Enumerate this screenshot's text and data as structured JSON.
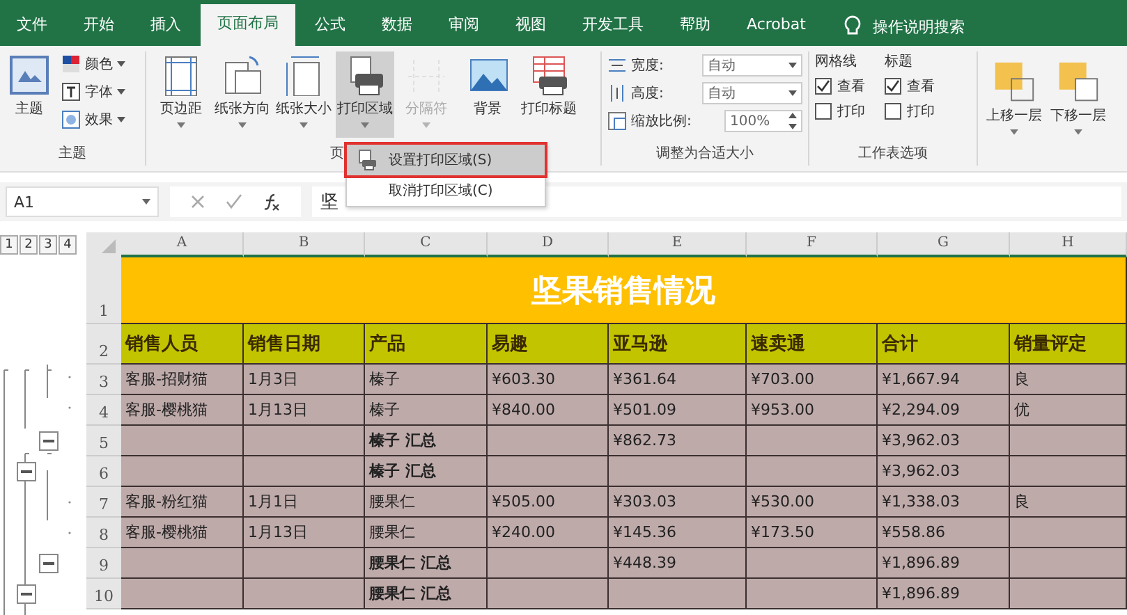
{
  "tabs": [
    {
      "label": "文件",
      "selected": false
    },
    {
      "label": "开始",
      "selected": false
    },
    {
      "label": "插入",
      "selected": false
    },
    {
      "label": "页面布局",
      "selected": true
    },
    {
      "label": "公式",
      "selected": false
    },
    {
      "label": "数据",
      "selected": false
    },
    {
      "label": "审阅",
      "selected": false
    },
    {
      "label": "视图",
      "selected": false
    },
    {
      "label": "开发工具",
      "selected": false
    },
    {
      "label": "帮助",
      "selected": false
    },
    {
      "label": "Acrobat",
      "selected": false
    }
  ],
  "tell_me": "操作说明搜索",
  "ribbon": {
    "theme_group": {
      "big_button": "主题",
      "small_buttons": [
        "颜色",
        "字体",
        "效果"
      ],
      "label": "主题"
    },
    "page_setup_group": {
      "buttons": [
        {
          "label": "页边距",
          "selected": false,
          "disabled": false
        },
        {
          "label": "纸张方向",
          "selected": false,
          "disabled": false
        },
        {
          "label": "纸张大小",
          "selected": false,
          "disabled": false
        },
        {
          "label": "打印区域",
          "selected": true,
          "disabled": false
        },
        {
          "label": "分隔符",
          "selected": false,
          "disabled": true
        },
        {
          "label": "背景",
          "selected": false,
          "disabled": false
        },
        {
          "label": "打印标题",
          "selected": false,
          "disabled": false
        }
      ],
      "label": "页"
    },
    "scale_group": {
      "fields": [
        {
          "label": "宽度:",
          "value": "自动",
          "kind": "dropdown"
        },
        {
          "label": "高度:",
          "value": "自动",
          "kind": "dropdown"
        },
        {
          "label": "缩放比例:",
          "value": "100%",
          "kind": "spinner"
        }
      ],
      "label": "调整为合适大小"
    },
    "sheet_options_group": {
      "columns": [
        {
          "heading": "网格线",
          "options": [
            {
              "label": "查看",
              "checked": true
            },
            {
              "label": "打印",
              "checked": false
            }
          ]
        },
        {
          "heading": "标题",
          "options": [
            {
              "label": "查看",
              "checked": true
            },
            {
              "label": "打印",
              "checked": false
            }
          ]
        }
      ],
      "label": "工作表选项"
    },
    "arrange_group": {
      "buttons": [
        "上移一层",
        "下移一层"
      ]
    }
  },
  "print_area_menu": {
    "items": [
      {
        "label": "设置打印区域(S)",
        "selected": true
      },
      {
        "label": "取消打印区域(C)",
        "selected": false
      }
    ]
  },
  "formula_bar": {
    "name_box": "A1",
    "content": "坚"
  },
  "outline_levels": [
    "1",
    "2",
    "3",
    "4"
  ],
  "columns": [
    "A",
    "B",
    "C",
    "D",
    "E",
    "F",
    "G",
    "H"
  ],
  "rows": [
    {
      "number": "1",
      "kind": "title",
      "cells": [
        "坚果销售情况"
      ]
    },
    {
      "number": "2",
      "kind": "header",
      "cells": [
        "销售人员",
        "销售日期",
        "产品",
        "易趣",
        "亚马逊",
        "速卖通",
        "合计",
        "销量评定"
      ]
    },
    {
      "number": "3",
      "kind": "data",
      "cells": [
        "客服-招财猫",
        "1月3日",
        "榛子",
        "¥603.30",
        "¥361.64",
        "¥703.00",
        "¥1,667.94",
        "良"
      ]
    },
    {
      "number": "4",
      "kind": "data",
      "cells": [
        "客服-樱桃猫",
        "1月13日",
        "榛子",
        "¥840.00",
        "¥501.09",
        "¥953.00",
        "¥2,294.09",
        "优"
      ]
    },
    {
      "number": "5",
      "kind": "subtotal",
      "cells": [
        "",
        "",
        "榛子 汇总",
        "",
        "¥862.73",
        "",
        "¥3,962.03",
        ""
      ]
    },
    {
      "number": "6",
      "kind": "total",
      "cells": [
        "",
        "",
        "榛子 汇总",
        "",
        "",
        "",
        "¥3,962.03",
        ""
      ]
    },
    {
      "number": "7",
      "kind": "data",
      "cells": [
        "客服-粉红猫",
        "1月1日",
        "腰果仁",
        "¥505.00",
        "¥303.03",
        "¥530.00",
        "¥1,338.03",
        "良"
      ]
    },
    {
      "number": "8",
      "kind": "data",
      "cells": [
        "客服-樱桃猫",
        "1月13日",
        "腰果仁",
        "¥240.00",
        "¥145.36",
        "¥173.50",
        "¥558.86",
        ""
      ]
    },
    {
      "number": "9",
      "kind": "subtotal",
      "cells": [
        "",
        "",
        "腰果仁 汇总",
        "",
        "¥448.39",
        "",
        "¥1,896.89",
        ""
      ]
    },
    {
      "number": "10",
      "kind": "total",
      "cells": [
        "",
        "",
        "腰果仁 汇总",
        "",
        "",
        "",
        "¥1,896.89",
        ""
      ]
    }
  ]
}
